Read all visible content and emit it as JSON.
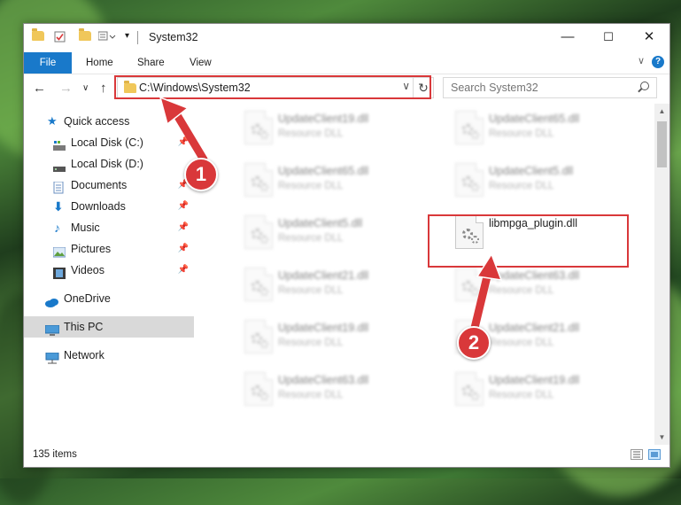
{
  "window": {
    "title": "System32",
    "controls": {
      "minimize": "—",
      "maximize": "☐",
      "close": "✕"
    }
  },
  "ribbon": {
    "tabs": [
      "File",
      "Home",
      "Share",
      "View"
    ],
    "help": "?"
  },
  "navigation": {
    "address": "C:\\Windows\\System32",
    "search_placeholder": "Search System32"
  },
  "sidebar": {
    "items": [
      {
        "label": "Quick access",
        "icon": "star-icon",
        "pinned": false
      },
      {
        "label": "Local Disk (C:)",
        "icon": "drive-icon",
        "pinned": true
      },
      {
        "label": "Local Disk (D:)",
        "icon": "drive-icon",
        "pinned": false
      },
      {
        "label": "Documents",
        "icon": "documents-icon",
        "pinned": true
      },
      {
        "label": "Downloads",
        "icon": "download-icon",
        "pinned": true
      },
      {
        "label": "Music",
        "icon": "music-icon",
        "pinned": true
      },
      {
        "label": "Pictures",
        "icon": "pictures-icon",
        "pinned": true
      },
      {
        "label": "Videos",
        "icon": "videos-icon",
        "pinned": true
      },
      {
        "label": "OneDrive",
        "icon": "cloud-icon",
        "pinned": false
      },
      {
        "label": "This PC",
        "icon": "computer-icon",
        "pinned": false
      },
      {
        "label": "Network",
        "icon": "network-icon",
        "pinned": false
      }
    ]
  },
  "files": [
    {
      "name": "UpdateClient19.dll",
      "type": "Resource DLL"
    },
    {
      "name": "UpdateClient65.dll",
      "type": "Resource DLL"
    },
    {
      "name": "UpdateClient65.dll",
      "type": "Resource DLL"
    },
    {
      "name": "UpdateClient5.dll",
      "type": "Resource DLL"
    },
    {
      "name": "UpdateClient5.dll",
      "type": "Resource DLL"
    },
    {
      "name": "libmpga_plugin.dll",
      "type": ""
    },
    {
      "name": "UpdateClient21.dll",
      "type": "Resource DLL"
    },
    {
      "name": "UpdateClient63.dll",
      "type": "Resource DLL"
    },
    {
      "name": "UpdateClient19.dll",
      "type": "Resource DLL"
    },
    {
      "name": "UpdateClient21.dll",
      "type": "Resource DLL"
    },
    {
      "name": "UpdateClient63.dll",
      "type": "Resource DLL"
    },
    {
      "name": "UpdateClient19.dll",
      "type": "Resource DLL"
    }
  ],
  "status": {
    "item_count": "135 items"
  },
  "annotations": {
    "step1": "1",
    "step2": "2",
    "color": "#d9383a"
  }
}
